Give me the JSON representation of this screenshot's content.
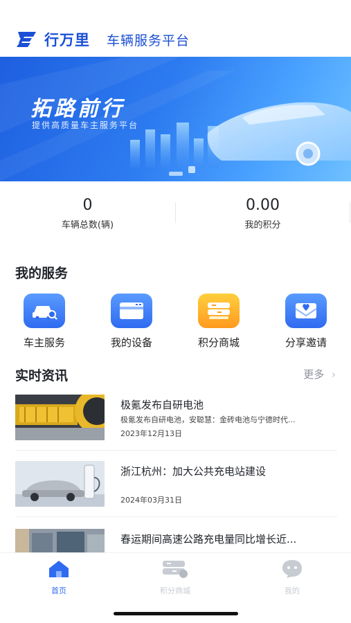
{
  "header": {
    "brand": "行万里",
    "subtitle": "车辆服务平台"
  },
  "banner": {
    "title": "拓路前行",
    "subtitle": "提供高质量车主服务平台"
  },
  "stats": [
    {
      "value": "0",
      "label": "车辆总数(辆)"
    },
    {
      "value": "0.00",
      "label": "我的积分"
    }
  ],
  "services": {
    "title": "我的服务",
    "items": [
      {
        "label": "车主服务",
        "icon": "car-search-icon"
      },
      {
        "label": "我的设备",
        "icon": "device-card-icon"
      },
      {
        "label": "积分商城",
        "icon": "points-mall-icon"
      },
      {
        "label": "分享邀请",
        "icon": "share-invite-icon"
      }
    ]
  },
  "news": {
    "title": "实时资讯",
    "more": "更多",
    "items": [
      {
        "title": "极氪发布自研电池",
        "summary": "极氪发布自研电池，安聪慧：金砖电池与宁德时代...",
        "date": "2023年12月13日"
      },
      {
        "title": "浙江杭州：加大公共充电站建设",
        "summary": "",
        "date": "2024年03月31日"
      },
      {
        "title": "春运期间高速公路充电量同比增长近...",
        "summary": "",
        "date": ""
      }
    ]
  },
  "tabbar": {
    "items": [
      {
        "label": "首页",
        "icon": "home-icon",
        "active": true
      },
      {
        "label": "积分商城",
        "icon": "points-mall-icon",
        "active": false
      },
      {
        "label": "我的",
        "icon": "profile-icon",
        "active": false
      }
    ]
  },
  "colors": {
    "accent": "#1a4fd6",
    "tab_active": "#2f6bf0",
    "tab_inactive": "#c7cbd2"
  }
}
